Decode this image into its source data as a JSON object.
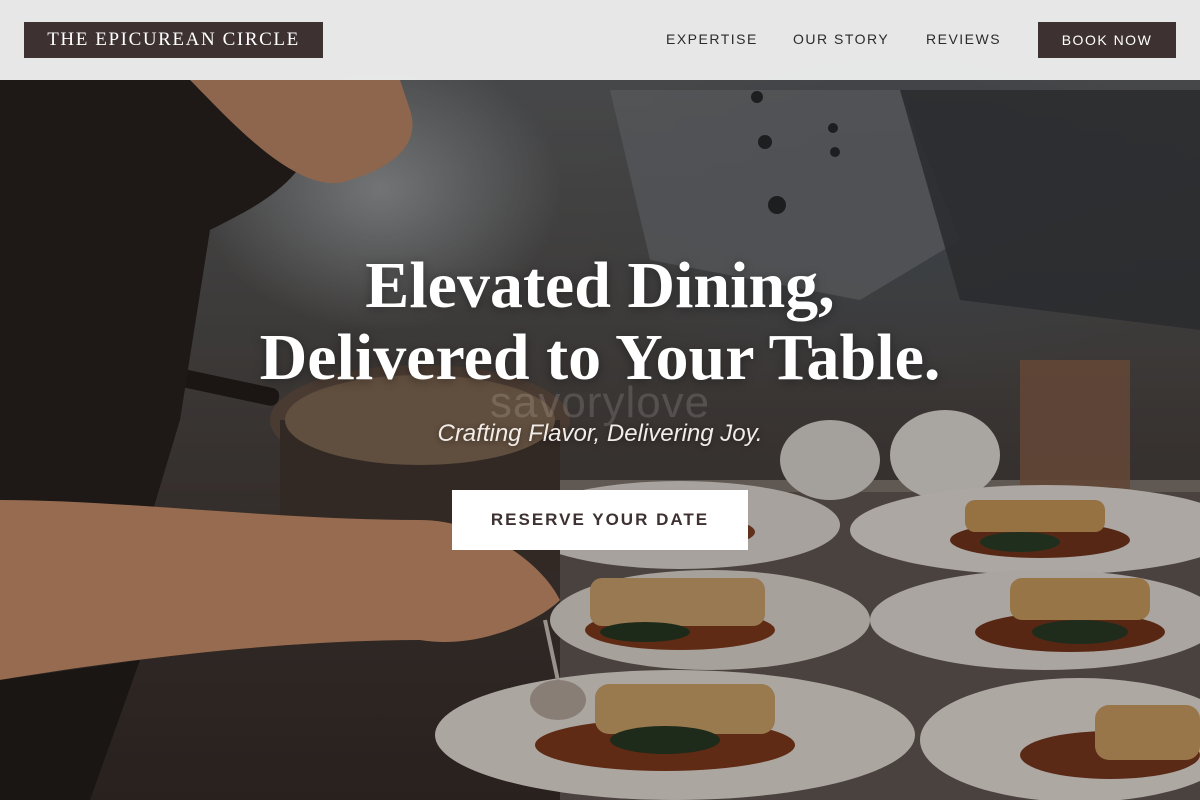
{
  "brand": {
    "logo_text": "THE EPICUREAN CIRCLE"
  },
  "nav": {
    "links": [
      {
        "label": "EXPERTISE"
      },
      {
        "label": "OUR STORY"
      },
      {
        "label": "REVIEWS"
      }
    ],
    "cta_label": "BOOK NOW"
  },
  "hero": {
    "headline_line1": "Elevated Dining,",
    "headline_line2": "Delivered to Your Table.",
    "watermark_text": "savorylove",
    "tagline": "Crafting Flavor, Delivering Joy.",
    "cta_label": "RESERVE YOUR DATE",
    "image_description_icon": "chef-plating-photo"
  },
  "colors": {
    "brand_dark": "#3d3131",
    "nav_background": "#f3f3f3",
    "hero_text": "#ffffff",
    "cta_background": "#ffffff"
  }
}
